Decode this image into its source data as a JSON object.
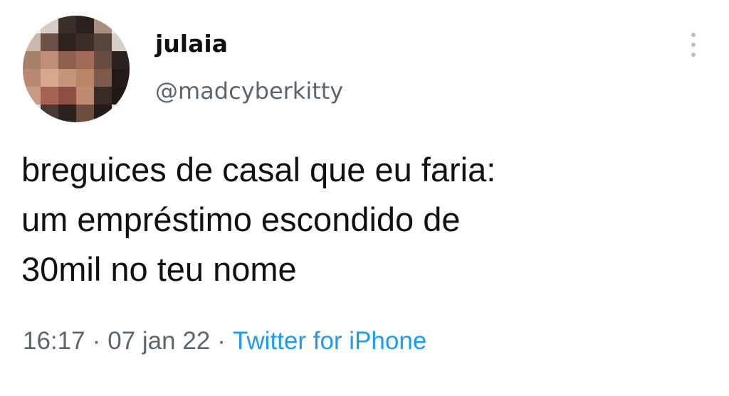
{
  "user": {
    "display_name": "julaia",
    "handle": "@madcyberkitty"
  },
  "tweet": {
    "lines": [
      "breguices de casal que eu faria:",
      "um empréstimo escondido de",
      "30mil no teu nome"
    ]
  },
  "meta": {
    "time": "16:17",
    "separator": "·",
    "date": "07 jan 22",
    "source": "Twitter for iPhone"
  },
  "icons": {
    "more": "more-vertical-icon",
    "avatar": "pixelated-avatar-image"
  },
  "colors": {
    "text": "#111111",
    "secondary": "#5b6570",
    "link": "#1d9bf0",
    "menu_dots": "#b6bec6"
  }
}
